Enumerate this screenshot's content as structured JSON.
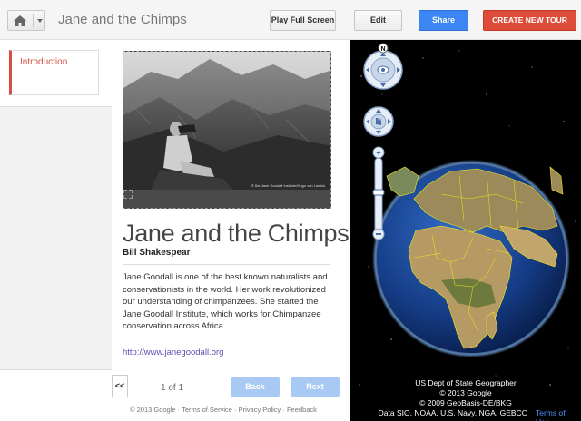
{
  "header": {
    "tour_title": "Jane and the Chimps",
    "play_full_screen": "Play Full Screen",
    "edit": "Edit",
    "share": "Share",
    "create_new_tour": "CREATE NEW TOUR"
  },
  "sidebar": {
    "items": [
      {
        "label": "Introduction",
        "selected": true
      }
    ],
    "prev_label": "<<"
  },
  "story": {
    "photo_credit": "© the Jane Goodall Institute/Hugo van Lawick",
    "title": "Jane and the Chimps",
    "author": "Bill Shakespear",
    "description": "Jane Goodall is one of the best known naturalists and conservationists in the world.  Her work revolutionized our understanding of chimpanzees.  She started the Jane Goodall Institute, which works for Chimpanzee conservation across Africa.",
    "link": "http://www.janegoodall.org"
  },
  "pager": {
    "page_text": "1 of 1",
    "back": "Back",
    "next": "Next"
  },
  "footer": {
    "text": "© 2013 Google  ·  Terms of Service  ·  Privacy Policy  ·  Feedback"
  },
  "earth": {
    "compass_letter": "N",
    "attribution": [
      "US Dept of State Geographer",
      "© 2013 Google",
      "© 2009 GeoBasis-DE/BKG",
      "Data SIO, NOAA, U.S. Navy, NGA, GEBCO"
    ],
    "terms": "Terms of Use"
  },
  "colors": {
    "accent_red": "#dd4b39",
    "share_blue": "#3b86f2",
    "pager_button": "#a9c9f5",
    "border_yellow": "#f5e91d"
  }
}
